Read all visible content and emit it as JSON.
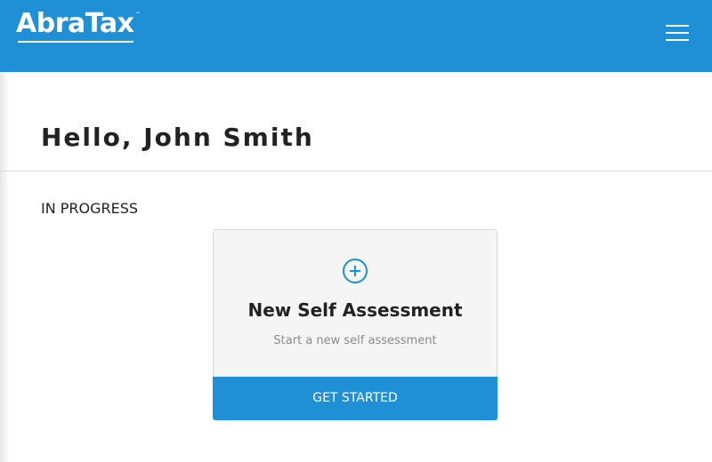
{
  "header": {
    "logo_text": "AbraTax",
    "logo_tm": "™",
    "menu_icon": "hamburger-menu-icon"
  },
  "main": {
    "greeting": "Hello, John Smith",
    "section_title": "IN PROGRESS",
    "card": {
      "icon": "plus-circle-icon",
      "title": "New Self Assessment",
      "subtitle": "Start a new self assessment",
      "button_label": "GET STARTED"
    }
  },
  "colors": {
    "brand_blue": "#1f8fd6",
    "card_bg": "#f5f5f5",
    "text_dark": "#222222",
    "text_muted": "#8a8a8a"
  }
}
